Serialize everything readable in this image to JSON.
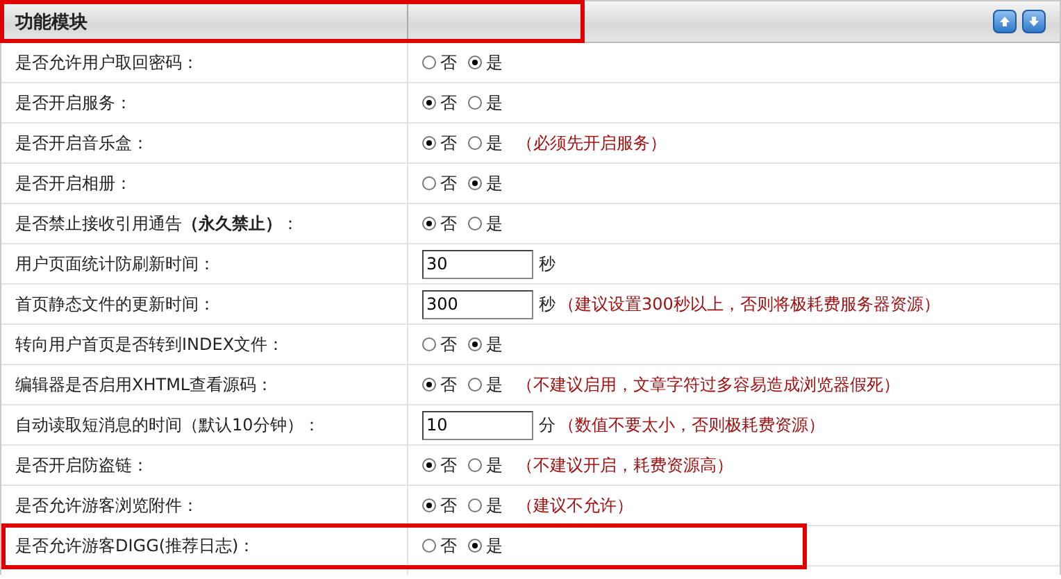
{
  "header": {
    "title": "功能模块",
    "highlighted": true
  },
  "rows": [
    {
      "kind": "radio",
      "label": "是否允许用户取回密码：",
      "options": [
        {
          "label": "否",
          "selected": false
        },
        {
          "label": "是",
          "selected": true
        }
      ]
    },
    {
      "kind": "radio",
      "label": "是否开启服务：",
      "options": [
        {
          "label": "否",
          "selected": true
        },
        {
          "label": "是",
          "selected": false
        }
      ]
    },
    {
      "kind": "radio",
      "label": "是否开启音乐盒：",
      "options": [
        {
          "label": "否",
          "selected": true
        },
        {
          "label": "是",
          "selected": false
        }
      ],
      "note": "（必须先开启服务）"
    },
    {
      "kind": "radio",
      "label": "是否开启相册：",
      "options": [
        {
          "label": "否",
          "selected": false
        },
        {
          "label": "是",
          "selected": true
        }
      ]
    },
    {
      "kind": "radio",
      "label": "是否禁止接收引用通告**（永久禁止）**：",
      "options": [
        {
          "label": "否",
          "selected": true
        },
        {
          "label": "是",
          "selected": false
        }
      ]
    },
    {
      "kind": "input",
      "label": "用户页面统计防刷新时间：",
      "value": "30",
      "unit": "秒"
    },
    {
      "kind": "input",
      "label": "首页静态文件的更新时间：",
      "value": "300",
      "unit": "秒",
      "note": "（建议设置300秒以上，否则将极耗费服务器资源）"
    },
    {
      "kind": "radio",
      "label": "转向用户首页是否转到INDEX文件：",
      "options": [
        {
          "label": "否",
          "selected": false
        },
        {
          "label": "是",
          "selected": true
        }
      ]
    },
    {
      "kind": "radio",
      "label": "编辑器是否启用XHTML查看源码：",
      "options": [
        {
          "label": "否",
          "selected": true
        },
        {
          "label": "是",
          "selected": false
        }
      ],
      "note": "（不建议启用，文章字符过多容易造成浏览器假死）"
    },
    {
      "kind": "input",
      "label": "自动读取短消息的时间（默认10分钟）：",
      "value": "10",
      "unit": "分",
      "note": "（数值不要太小，否则极耗费资源）"
    },
    {
      "kind": "radio",
      "label": "是否开启防盗链：",
      "options": [
        {
          "label": "否",
          "selected": true
        },
        {
          "label": "是",
          "selected": false
        }
      ],
      "note": "（不建议开启，耗费资源高）"
    },
    {
      "kind": "radio",
      "label": "是否允许游客浏览附件：",
      "options": [
        {
          "label": "否",
          "selected": true
        },
        {
          "label": "是",
          "selected": false
        }
      ],
      "note": "（建议不允许）"
    },
    {
      "kind": "radio",
      "label": "是否允许游客DIGG(推荐日志)：",
      "options": [
        {
          "label": "否",
          "selected": false
        },
        {
          "label": "是",
          "selected": true
        }
      ],
      "highlighted": true
    }
  ]
}
